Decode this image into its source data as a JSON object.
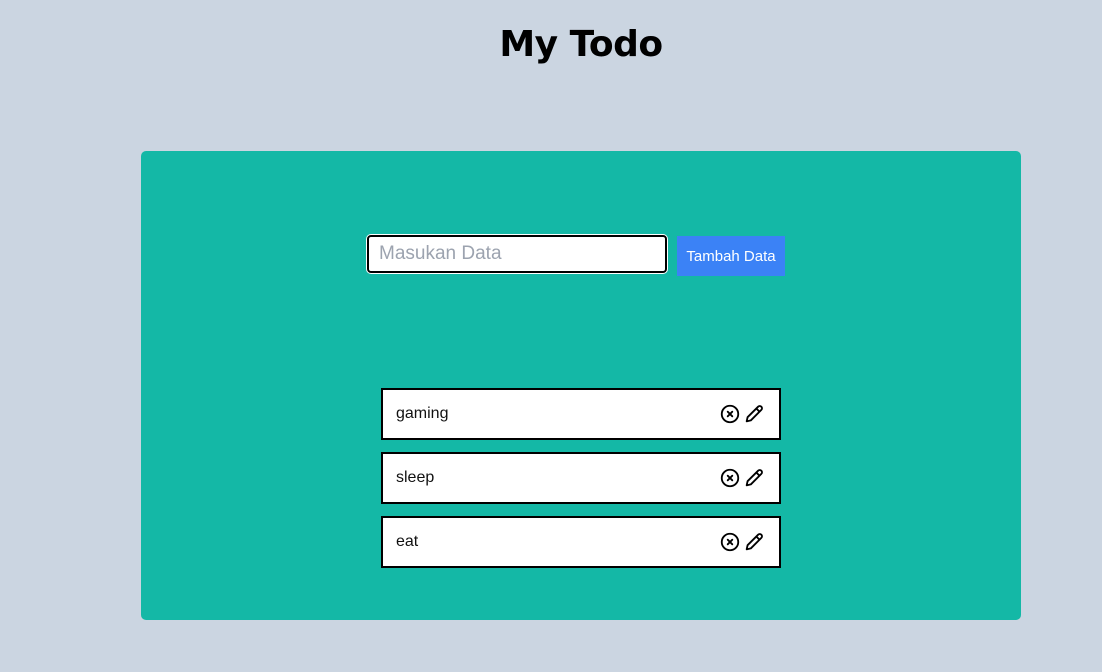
{
  "header": {
    "title": "My Todo"
  },
  "form": {
    "placeholder": "Masukan Data",
    "value": "",
    "add_label": "Tambah Data"
  },
  "todos": [
    {
      "text": "gaming",
      "delete_icon": "circle-x-icon",
      "edit_icon": "pencil-icon"
    },
    {
      "text": "sleep",
      "delete_icon": "circle-x-icon",
      "edit_icon": "pencil-icon"
    },
    {
      "text": "eat",
      "delete_icon": "circle-x-icon",
      "edit_icon": "pencil-icon"
    }
  ],
  "colors": {
    "background": "#cbd5e1",
    "card": "#14b8a6",
    "button": "#3b82f6"
  }
}
